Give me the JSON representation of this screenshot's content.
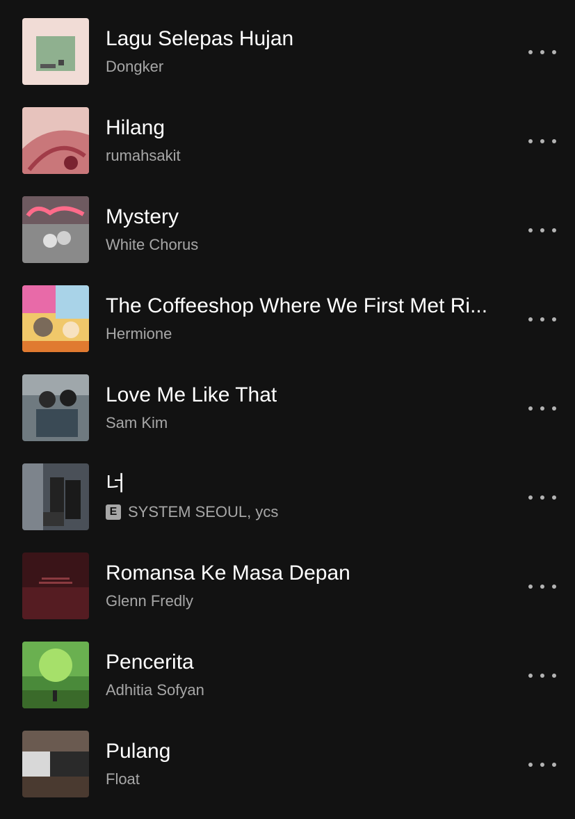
{
  "tracks": [
    {
      "title": "Lagu Selepas Hujan",
      "artist": "Dongker",
      "explicit": false,
      "cover_icon": "album-cover-icon"
    },
    {
      "title": "Hilang",
      "artist": "rumahsakit",
      "explicit": false,
      "cover_icon": "album-cover-icon"
    },
    {
      "title": "Mystery",
      "artist": "White Chorus",
      "explicit": false,
      "cover_icon": "album-cover-icon"
    },
    {
      "title": "The Coffeeshop Where We First Met Ri...",
      "artist": "Hermione",
      "explicit": false,
      "cover_icon": "album-cover-icon"
    },
    {
      "title": "Love Me Like That",
      "artist": "Sam Kim",
      "explicit": false,
      "cover_icon": "album-cover-icon"
    },
    {
      "title": "너",
      "artist": "SYSTEM SEOUL, ycs",
      "explicit": true,
      "explicit_label": "E",
      "cover_icon": "album-cover-icon"
    },
    {
      "title": "Romansa Ke Masa Depan",
      "artist": "Glenn Fredly",
      "explicit": false,
      "cover_icon": "album-cover-icon"
    },
    {
      "title": "Pencerita",
      "artist": "Adhitia Sofyan",
      "explicit": false,
      "cover_icon": "album-cover-icon"
    },
    {
      "title": "Pulang",
      "artist": "Float",
      "explicit": false,
      "cover_icon": "album-cover-icon"
    }
  ],
  "more_icon": "more-options-icon",
  "colors": {
    "background": "#121212",
    "title": "#ffffff",
    "subtitle": "#a7a7a7"
  }
}
